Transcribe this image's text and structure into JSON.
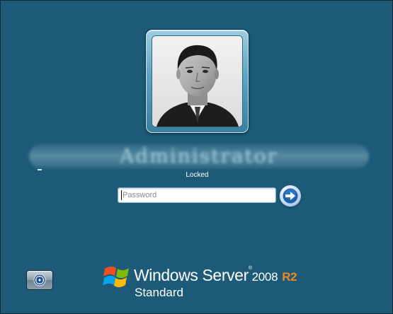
{
  "user": {
    "display_name": "Administrator",
    "status": "Locked"
  },
  "password_field": {
    "placeholder": "Password",
    "value": ""
  },
  "branding": {
    "product": "Windows Server",
    "trademark": "®",
    "version": "2008",
    "release": "R2",
    "edition": "Standard"
  },
  "colors": {
    "background": "#1c5a77",
    "accent_r2": "#f08a1c",
    "text": "#ffffff"
  },
  "icons": {
    "submit": "arrow-right-icon",
    "ease_of_access": "ease-of-access-icon",
    "logo": "windows-flag-logo"
  }
}
